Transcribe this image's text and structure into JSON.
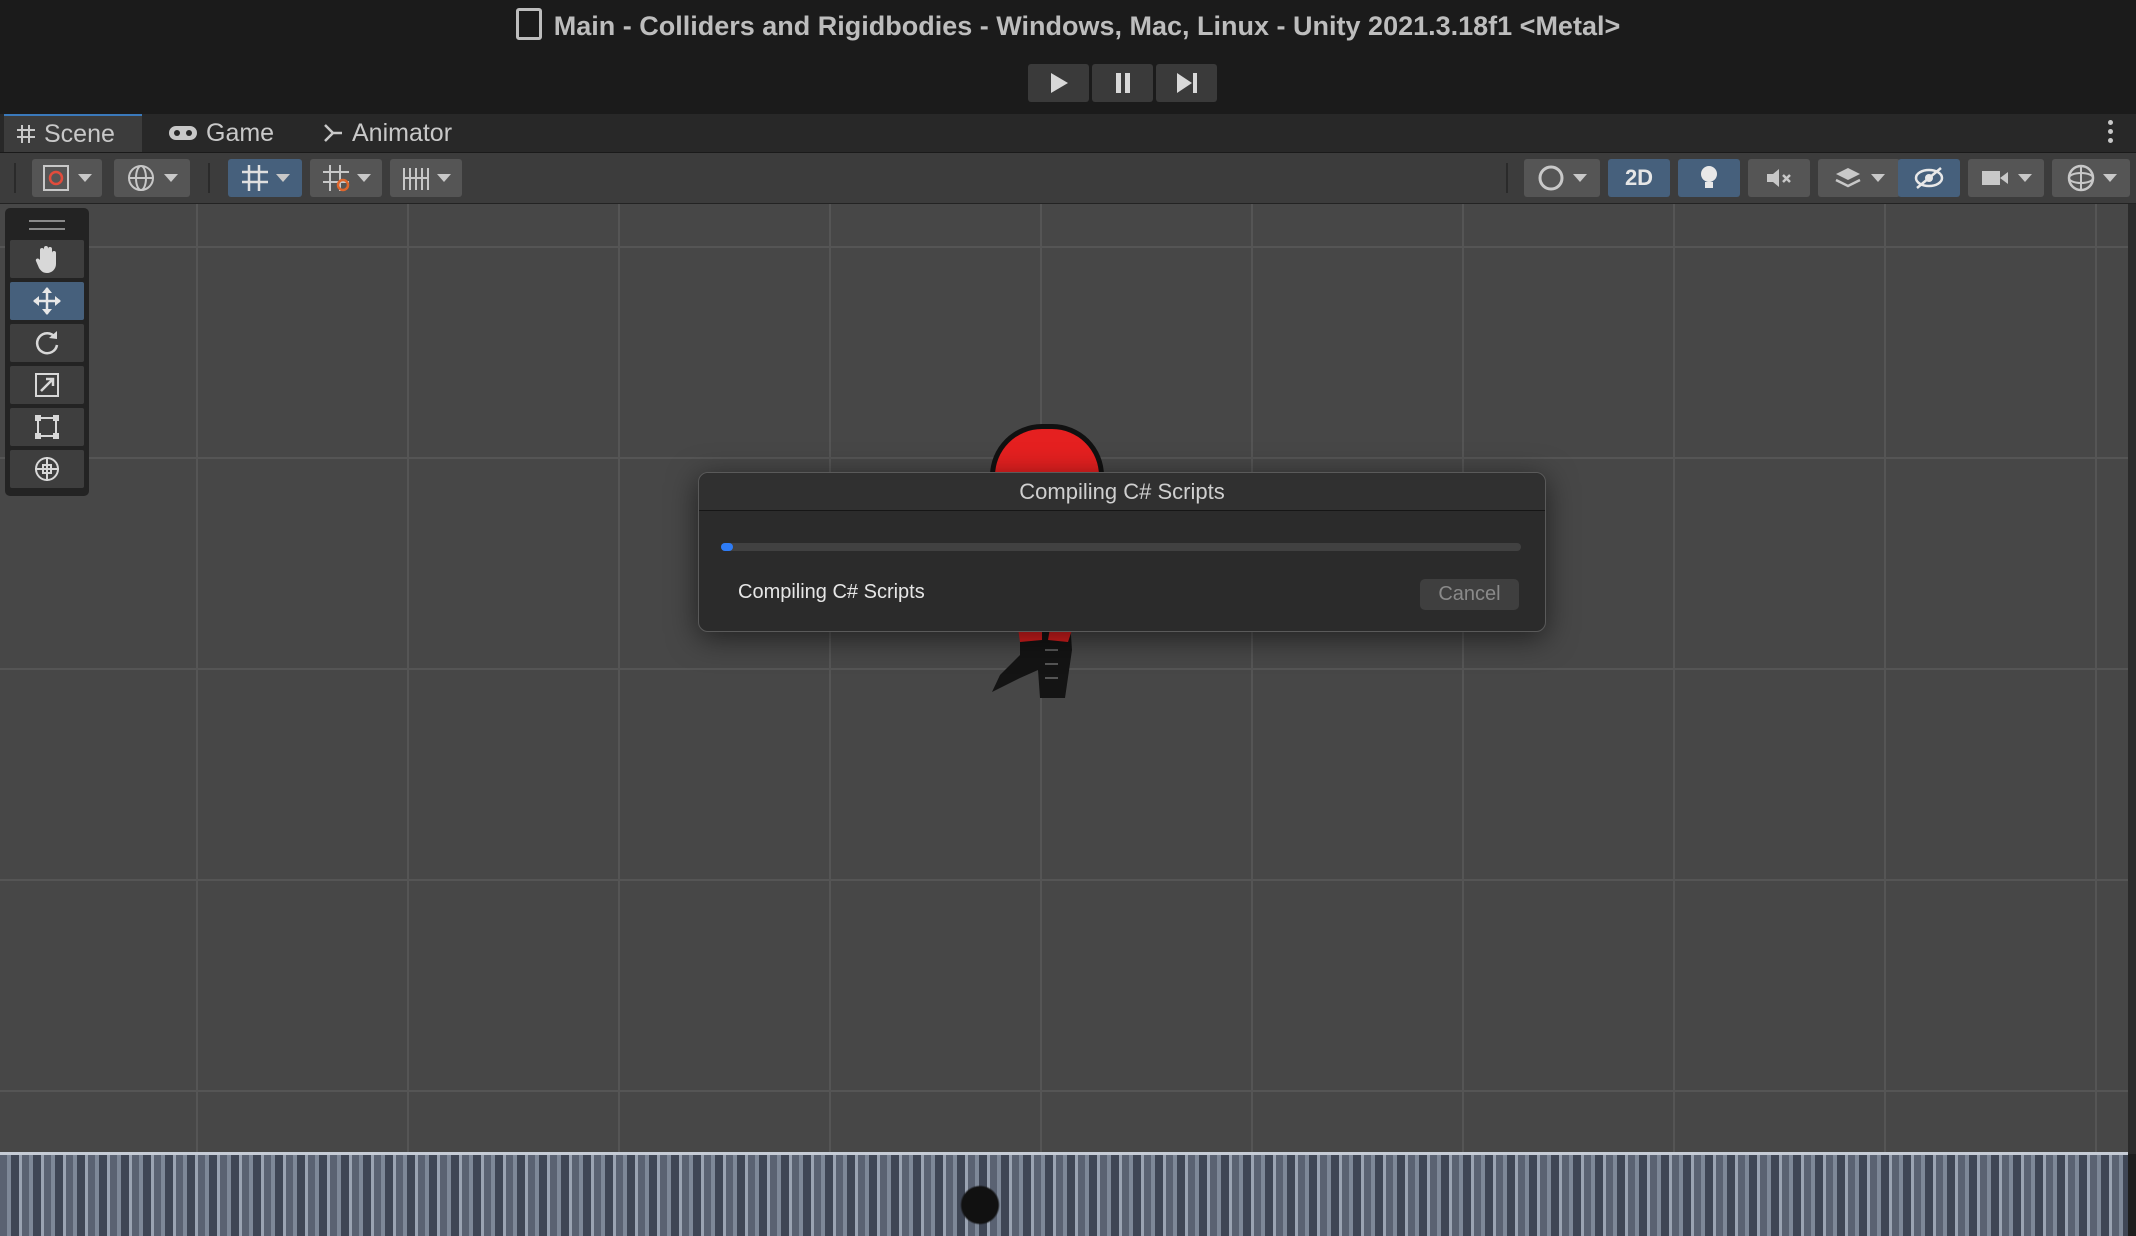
{
  "window": {
    "title": "Main - Colliders and Rigidbodies - Windows, Mac, Linux - Unity 2021.3.18f1 <Metal>"
  },
  "playbar": {
    "buttons": [
      {
        "name": "play",
        "icon": "play-icon"
      },
      {
        "name": "pause",
        "icon": "pause-icon"
      },
      {
        "name": "step",
        "icon": "step-icon"
      }
    ]
  },
  "tabs": [
    {
      "label": "Scene",
      "icon": "grid-icon",
      "active": true
    },
    {
      "label": "Game",
      "icon": "gamepad-icon",
      "active": false
    },
    {
      "label": "Animator",
      "icon": "animator-icon",
      "active": false
    }
  ],
  "toolbar": {
    "mode_2d_label": "2D",
    "active_color": "#46607c"
  },
  "tools": [
    "hand-tool",
    "move-tool",
    "rotate-tool",
    "scale-tool",
    "rect-tool",
    "transform-tool"
  ],
  "active_tool": "move-tool",
  "dialog": {
    "title": "Compiling C# Scripts",
    "status": "Compiling C# Scripts",
    "cancel_label": "Cancel",
    "progress_fraction": 0.015,
    "progress_color": "#2e7cf6"
  }
}
